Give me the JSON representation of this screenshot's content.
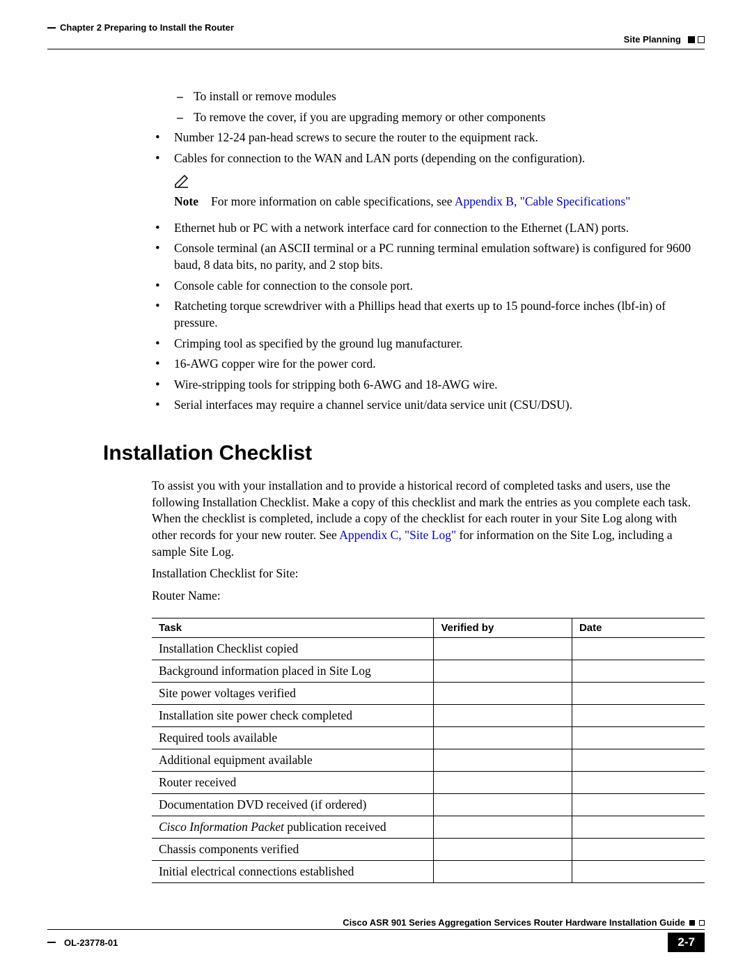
{
  "header": {
    "chapter": "Chapter 2      Preparing to Install the Router",
    "section": "Site Planning"
  },
  "list": {
    "d1": "To install or remove modules",
    "d2": "To remove the cover, if you are upgrading memory or other components",
    "b1": "Number 12-24 pan-head screws to secure the router to the equipment rack.",
    "b2": "Cables for connection to the WAN and LAN ports (depending on the configuration).",
    "note_label": "Note",
    "note_text_pre": "For more information on cable specifications, see ",
    "note_link": "Appendix B, \"Cable Specifications\"",
    "b3": "Ethernet hub or PC with a network interface card for connection to the Ethernet (LAN) ports.",
    "b4": "Console terminal (an ASCII terminal or a PC running terminal emulation software) is configured for 9600 baud, 8 data bits, no parity, and 2 stop bits.",
    "b5": "Console cable for connection to the console port.",
    "b6": "Ratcheting torque screwdriver with a Phillips head that exerts up to 15 pound-force inches (lbf-in) of pressure.",
    "b7": "Crimping tool as specified by the ground lug manufacturer.",
    "b8": "16-AWG copper wire for the power cord.",
    "b9": "Wire-stripping tools for stripping both 6-AWG and 18-AWG wire.",
    "b10": "Serial interfaces may require a channel service unit/data service unit (CSU/DSU)."
  },
  "section": {
    "heading": "Installation Checklist",
    "para_pre": "To assist you with your installation and to provide a historical record of completed tasks and users, use the following Installation Checklist. Make a copy of this checklist and mark the entries as you complete each task. When the checklist is completed, include a copy of the checklist for each router in your Site Log along with other records for your new router. See ",
    "para_link": "Appendix C, \"Site Log\"",
    "para_post": " for information on the Site Log, including a sample Site Log.",
    "line1": "Installation Checklist for Site:",
    "line2": "Router Name:"
  },
  "table": {
    "head": {
      "task": "Task",
      "vby": "Verified by",
      "date": "Date"
    },
    "rows": [
      {
        "task": "Installation Checklist copied"
      },
      {
        "task": "Background information placed in Site Log"
      },
      {
        "task": "Site power voltages verified"
      },
      {
        "task": "Installation site power check completed"
      },
      {
        "task": "Required tools available"
      },
      {
        "task": "Additional equipment available"
      },
      {
        "task": "Router received"
      },
      {
        "task": "Documentation DVD received (if ordered)"
      },
      {
        "task_italic": "Cisco Information Packet",
        "task_rest": " publication received"
      },
      {
        "task": "Chassis components verified"
      },
      {
        "task": "Initial electrical connections established"
      }
    ]
  },
  "footer": {
    "guide": "Cisco ASR 901 Series Aggregation Services Router Hardware Installation Guide",
    "docnum": "OL-23778-01",
    "page": "2-7"
  }
}
